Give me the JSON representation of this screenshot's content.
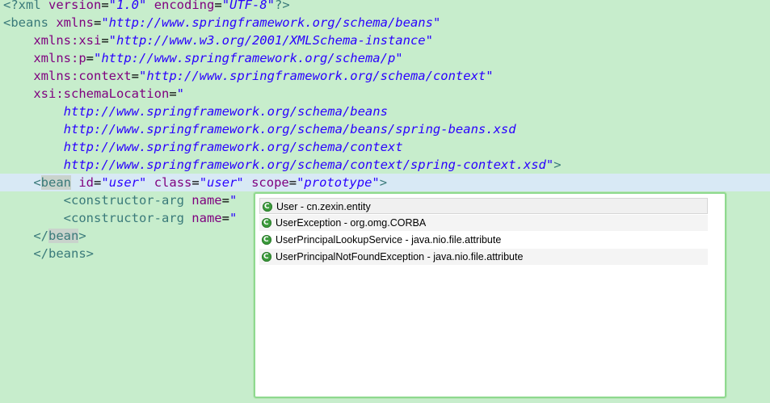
{
  "editor": {
    "lines": [
      {
        "segments": [
          {
            "c": "tag",
            "t": "<?xml "
          },
          {
            "c": "attr",
            "t": "version"
          },
          {
            "c": "plain",
            "t": "="
          },
          {
            "c": "str",
            "t": "\"1.0\""
          },
          {
            "c": "plain",
            "t": " "
          },
          {
            "c": "attr",
            "t": "encoding"
          },
          {
            "c": "plain",
            "t": "="
          },
          {
            "c": "str",
            "t": "\"UTF-8\""
          },
          {
            "c": "tag",
            "t": "?>"
          }
        ]
      },
      {
        "segments": [
          {
            "c": "tag",
            "t": "<beans "
          },
          {
            "c": "attr",
            "t": "xmlns"
          },
          {
            "c": "plain",
            "t": "="
          },
          {
            "c": "str",
            "t": "\"http://www.springframework.org/schema/beans\""
          }
        ]
      },
      {
        "segments": [
          {
            "c": "plain",
            "t": "    "
          },
          {
            "c": "attr",
            "t": "xmlns:xsi"
          },
          {
            "c": "plain",
            "t": "="
          },
          {
            "c": "str",
            "t": "\"http://www.w3.org/2001/XMLSchema-instance\""
          }
        ]
      },
      {
        "segments": [
          {
            "c": "plain",
            "t": "    "
          },
          {
            "c": "attr",
            "t": "xmlns:p"
          },
          {
            "c": "plain",
            "t": "="
          },
          {
            "c": "str",
            "t": "\"http://www.springframework.org/schema/p\""
          }
        ]
      },
      {
        "segments": [
          {
            "c": "plain",
            "t": "    "
          },
          {
            "c": "attr",
            "t": "xmlns:context"
          },
          {
            "c": "plain",
            "t": "="
          },
          {
            "c": "str",
            "t": "\"http://www.springframework.org/schema/context\""
          }
        ]
      },
      {
        "segments": [
          {
            "c": "plain",
            "t": "    "
          },
          {
            "c": "attr",
            "t": "xsi:schemaLocation"
          },
          {
            "c": "plain",
            "t": "="
          },
          {
            "c": "str",
            "t": "\""
          }
        ]
      },
      {
        "segments": [
          {
            "c": "plain",
            "t": "        "
          },
          {
            "c": "str",
            "t": "http://www.springframework.org/schema/beans"
          }
        ]
      },
      {
        "segments": [
          {
            "c": "plain",
            "t": "        "
          },
          {
            "c": "str",
            "t": "http://www.springframework.org/schema/beans/spring-beans.xsd"
          }
        ]
      },
      {
        "segments": [
          {
            "c": "plain",
            "t": "        "
          },
          {
            "c": "str",
            "t": "http://www.springframework.org/schema/context"
          }
        ]
      },
      {
        "segments": [
          {
            "c": "plain",
            "t": "        "
          },
          {
            "c": "str",
            "t": "http://www.springframework.org/schema/context/spring-context.xsd\""
          },
          {
            "c": "tag",
            "t": ">"
          }
        ]
      },
      {
        "current": true,
        "segments": [
          {
            "c": "plain",
            "t": "    "
          },
          {
            "c": "tag",
            "t": "<"
          },
          {
            "c": "tag hlbean",
            "t": "bean"
          },
          {
            "c": "plain",
            "t": " "
          },
          {
            "c": "attr",
            "t": "id"
          },
          {
            "c": "plain",
            "t": "="
          },
          {
            "c": "str",
            "t": "\"user\""
          },
          {
            "c": "plain",
            "t": " "
          },
          {
            "c": "attr",
            "t": "class"
          },
          {
            "c": "plain",
            "t": "="
          },
          {
            "c": "str",
            "t": "\"user"
          },
          {
            "c": "caret",
            "t": ""
          },
          {
            "c": "str",
            "t": "\""
          },
          {
            "c": "plain",
            "t": " "
          },
          {
            "c": "attr",
            "t": "scope"
          },
          {
            "c": "plain",
            "t": "="
          },
          {
            "c": "str",
            "t": "\"prototype\""
          },
          {
            "c": "tag",
            "t": ">"
          }
        ]
      },
      {
        "segments": [
          {
            "c": "plain",
            "t": "        "
          },
          {
            "c": "tag",
            "t": "<constructor-arg "
          },
          {
            "c": "attr",
            "t": "name"
          },
          {
            "c": "plain",
            "t": "="
          },
          {
            "c": "str",
            "t": "\""
          }
        ]
      },
      {
        "segments": [
          {
            "c": "plain",
            "t": "        "
          },
          {
            "c": "tag",
            "t": "<constructor-arg "
          },
          {
            "c": "attr",
            "t": "name"
          },
          {
            "c": "plain",
            "t": "="
          },
          {
            "c": "str",
            "t": "\""
          }
        ]
      },
      {
        "segments": [
          {
            "c": "plain",
            "t": "    "
          },
          {
            "c": "tag",
            "t": "</"
          },
          {
            "c": "tag hlbean",
            "t": "bean"
          },
          {
            "c": "tag",
            "t": ">"
          }
        ]
      },
      {
        "segments": [
          {
            "c": "plain",
            "t": "    "
          },
          {
            "c": "tag",
            "t": "</beans>"
          }
        ]
      }
    ]
  },
  "content_assist": {
    "proposals": [
      {
        "label": "User - cn.zexin.entity",
        "icon": "class-icon",
        "selected": true
      },
      {
        "label": "UserException - org.omg.CORBA",
        "icon": "class-icon-abstract",
        "selected": false
      },
      {
        "label": "UserPrincipalLookupService - java.nio.file.attribute",
        "icon": "class-icon-abstract",
        "selected": false
      },
      {
        "label": "UserPrincipalNotFoundException - java.nio.file.attribute",
        "icon": "class-icon",
        "selected": false
      }
    ]
  },
  "colors": {
    "editor_background": "#c7edcc",
    "current_line": "#d8e9f5",
    "popup_border": "#8fd98f",
    "string": "#2a00ff",
    "attribute": "#7f007f",
    "tag": "#3a7a7a"
  }
}
